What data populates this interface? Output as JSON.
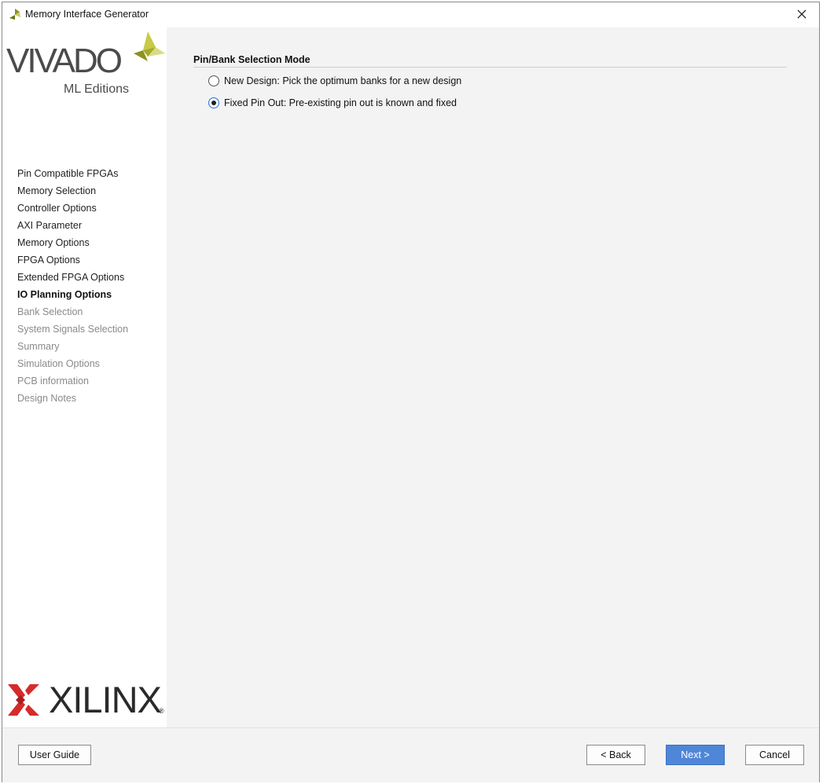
{
  "window": {
    "title": "Memory Interface Generator"
  },
  "branding": {
    "vivado_word": "VIVADO",
    "vivado_sub": "ML Editions",
    "xilinx_word": "XILINX",
    "xilinx_reg": "®"
  },
  "sidebar": {
    "steps": [
      {
        "label": "Pin Compatible FPGAs",
        "state": "done"
      },
      {
        "label": "Memory Selection",
        "state": "done"
      },
      {
        "label": "Controller Options",
        "state": "done"
      },
      {
        "label": "AXI Parameter",
        "state": "done"
      },
      {
        "label": "Memory Options",
        "state": "done"
      },
      {
        "label": "FPGA Options",
        "state": "done"
      },
      {
        "label": "Extended FPGA Options",
        "state": "done"
      },
      {
        "label": "IO Planning Options",
        "state": "active"
      },
      {
        "label": "Bank Selection",
        "state": "pending"
      },
      {
        "label": "System Signals Selection",
        "state": "pending"
      },
      {
        "label": "Summary",
        "state": "pending"
      },
      {
        "label": "Simulation Options",
        "state": "pending"
      },
      {
        "label": "PCB information",
        "state": "pending"
      },
      {
        "label": "Design Notes",
        "state": "pending"
      }
    ]
  },
  "main": {
    "section_title": "Pin/Bank Selection Mode",
    "options": [
      {
        "label": "New Design: Pick the optimum banks for a new design",
        "checked": false
      },
      {
        "label": "Fixed Pin Out: Pre-existing pin out is known and fixed",
        "checked": true
      }
    ]
  },
  "footer": {
    "user_guide": "User Guide",
    "back": "< Back",
    "next": "Next >",
    "cancel": "Cancel"
  },
  "colors": {
    "accent": "#4f86d8",
    "xilinx_red": "#d62b2b",
    "vivado_green": "#b4b432"
  }
}
